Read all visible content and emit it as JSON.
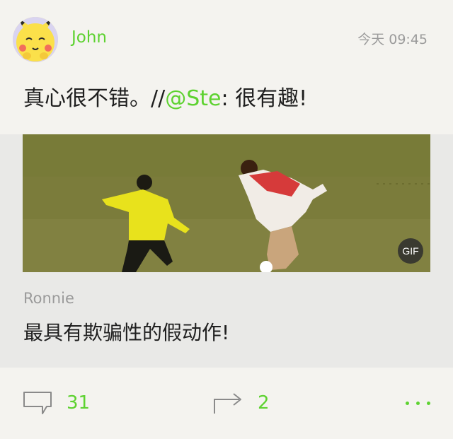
{
  "post": {
    "author": "John",
    "timestamp": "今天 09:45",
    "text_before": "真心很不错。//",
    "mention": "@Ste",
    "text_after": ": 很有趣!"
  },
  "repost": {
    "media_badge": "GIF",
    "author": "Ronnie",
    "text": "最具有欺骗性的假动作!"
  },
  "actions": {
    "comment_count": "31",
    "repost_count": "2"
  },
  "colors": {
    "accent": "#5dd230",
    "background": "#f4f3ef",
    "repost_background": "#e9e9e7",
    "secondary_text": "#9b9b9b"
  },
  "icons": {
    "avatar": "pikachu-avatar",
    "comment": "comment-bubble-icon",
    "repost": "repost-arrow-icon",
    "more": "more-dots-icon"
  }
}
